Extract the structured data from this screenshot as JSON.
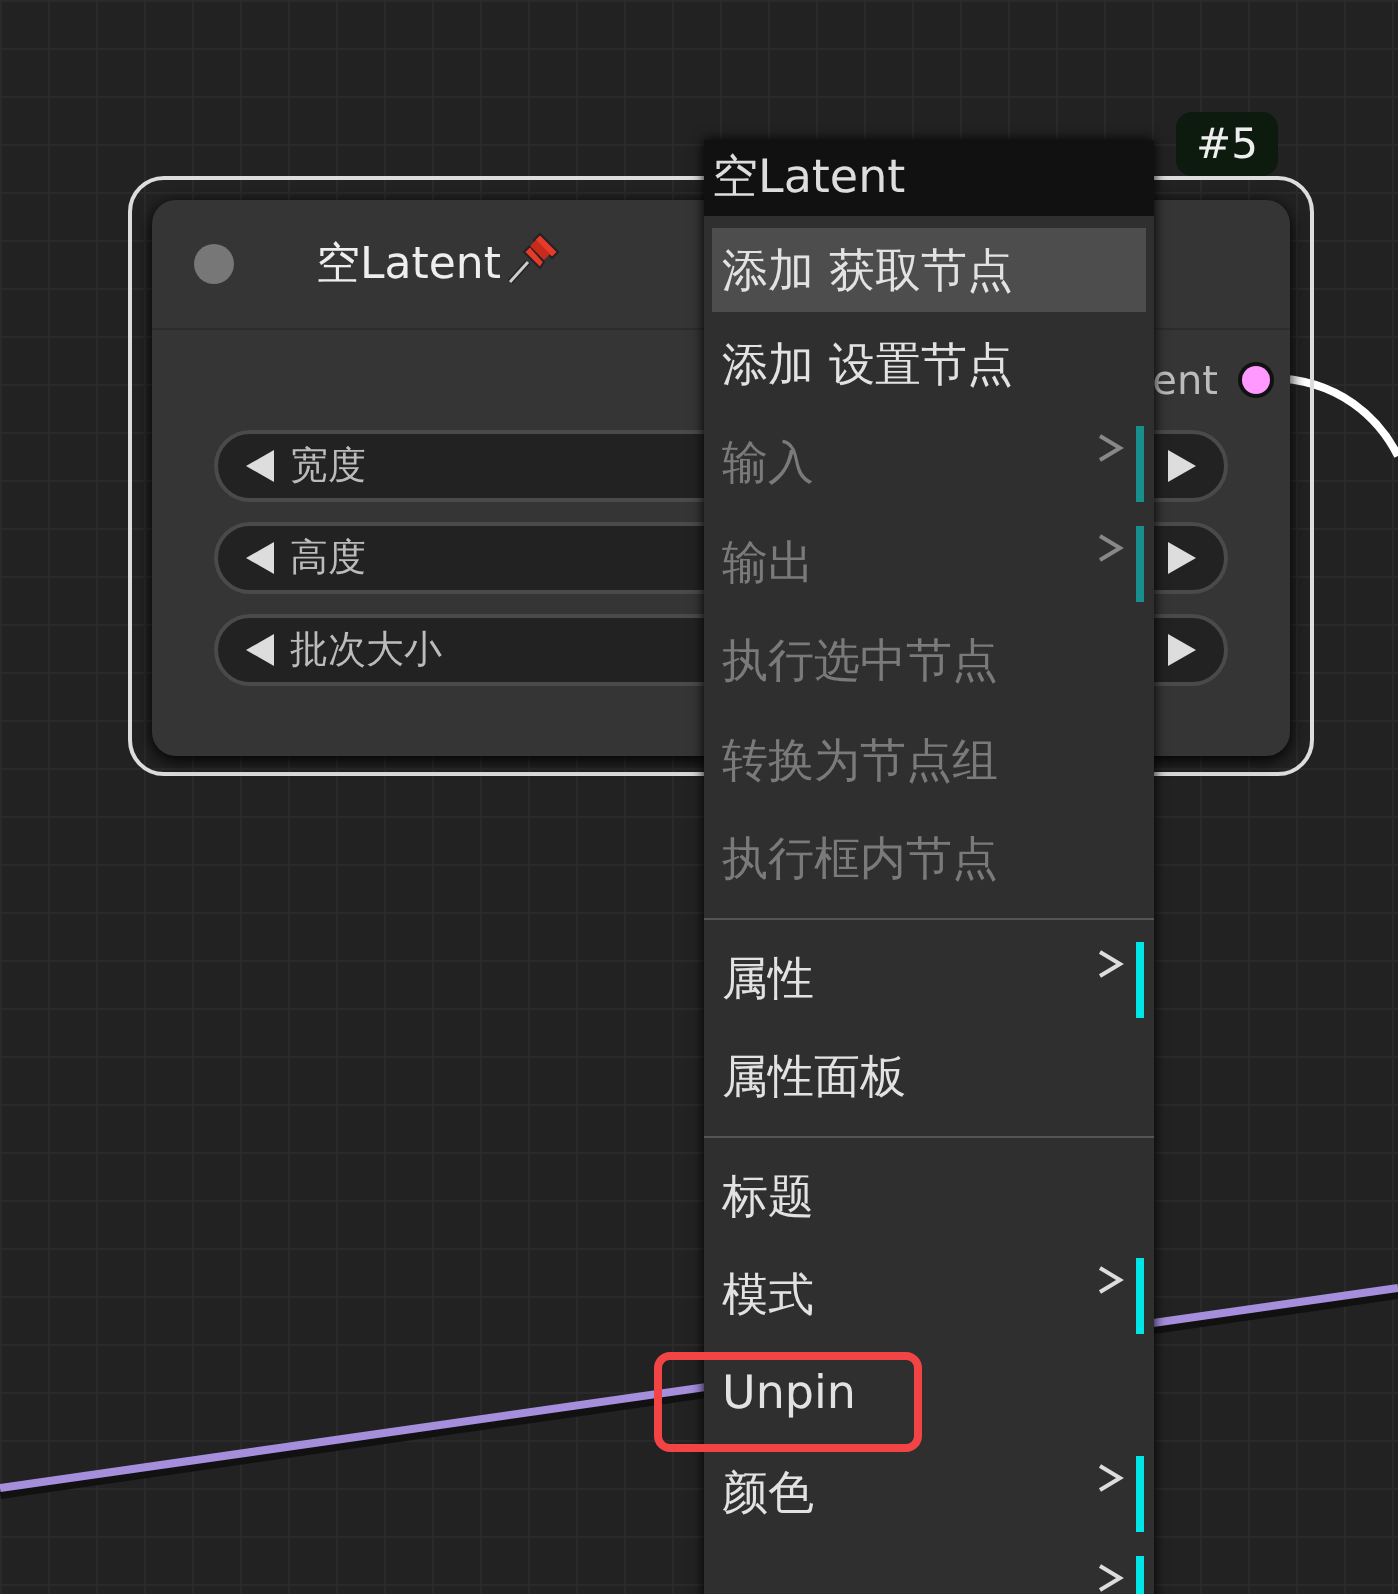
{
  "node": {
    "title": "空Latent",
    "pinned": true,
    "selected": true,
    "badge": "#5",
    "output": {
      "label": "ent",
      "color": "#ff99ff"
    },
    "widgets": [
      {
        "label": "宽度"
      },
      {
        "label": "高度"
      },
      {
        "label": "批次大小"
      }
    ]
  },
  "context_menu": {
    "title": "空Latent",
    "items": [
      {
        "kind": "item",
        "label": "添加 获取节点",
        "selected": true,
        "disabled": false,
        "submenu": false,
        "marked": false
      },
      {
        "kind": "item",
        "label": "添加 设置节点",
        "selected": false,
        "disabled": false,
        "submenu": false,
        "marked": false
      },
      {
        "kind": "item",
        "label": "输入",
        "selected": false,
        "disabled": true,
        "submenu": true,
        "marked": false
      },
      {
        "kind": "item",
        "label": "输出",
        "selected": false,
        "disabled": true,
        "submenu": true,
        "marked": false
      },
      {
        "kind": "item",
        "label": "执行选中节点",
        "selected": false,
        "disabled": true,
        "submenu": false,
        "marked": false
      },
      {
        "kind": "item",
        "label": "转换为节点组",
        "selected": false,
        "disabled": true,
        "submenu": false,
        "marked": false
      },
      {
        "kind": "item",
        "label": "执行框内节点",
        "selected": false,
        "disabled": true,
        "submenu": false,
        "marked": false
      },
      {
        "kind": "separator"
      },
      {
        "kind": "item",
        "label": "属性",
        "selected": false,
        "disabled": false,
        "submenu": true,
        "marked": false
      },
      {
        "kind": "item",
        "label": "属性面板",
        "selected": false,
        "disabled": false,
        "submenu": false,
        "marked": false
      },
      {
        "kind": "separator"
      },
      {
        "kind": "item",
        "label": "标题",
        "selected": false,
        "disabled": false,
        "submenu": false,
        "marked": false
      },
      {
        "kind": "item",
        "label": "模式",
        "selected": false,
        "disabled": false,
        "submenu": true,
        "marked": false
      },
      {
        "kind": "item",
        "label": "Unpin",
        "selected": false,
        "disabled": false,
        "submenu": false,
        "marked": true
      },
      {
        "kind": "item",
        "label": "颜色",
        "selected": false,
        "disabled": false,
        "submenu": true,
        "marked": false
      },
      {
        "kind": "item",
        "selected": false,
        "disabled": false,
        "submenu": true,
        "marked": false
      }
    ]
  }
}
